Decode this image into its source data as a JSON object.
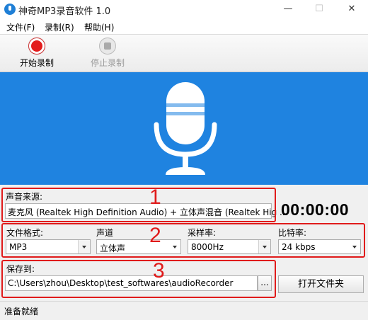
{
  "window": {
    "title": "神奇MP3录音软件 1.0",
    "min": "—",
    "max": "☐",
    "close": "✕"
  },
  "menu": [
    "文件(F)",
    "录制(R)",
    "帮助(H)"
  ],
  "toolbar": {
    "start": "开始录制",
    "stop": "停止录制"
  },
  "source": {
    "label": "声音来源:",
    "value": "麦克风 (Realtek High Definition Audio) + 立体声混音 (Realtek Hig ..."
  },
  "timer": "00:00:00",
  "format": {
    "label": "文件格式:",
    "value": "MP3"
  },
  "channel": {
    "label": "声道",
    "value": "立体声"
  },
  "samplerate": {
    "label": "采样率:",
    "value": "8000Hz"
  },
  "bitrate": {
    "label": "比特率:",
    "value": "24 kbps"
  },
  "save": {
    "label": "保存到:",
    "path": "C:\\Users\\zhou\\Desktop\\test_softwares\\audioRecorder",
    "browse": "...",
    "open_folder": "打开文件夹"
  },
  "annotations": [
    "1",
    "2",
    "3"
  ],
  "status": "准备就绪",
  "colors": {
    "banner": "#1f83e0",
    "annotation": "#e01b1b",
    "record": "#e31c1c"
  },
  "icons": {
    "app": "microphone-app-icon",
    "record": "record-icon",
    "stop": "stop-icon",
    "banner": "microphone-icon"
  }
}
